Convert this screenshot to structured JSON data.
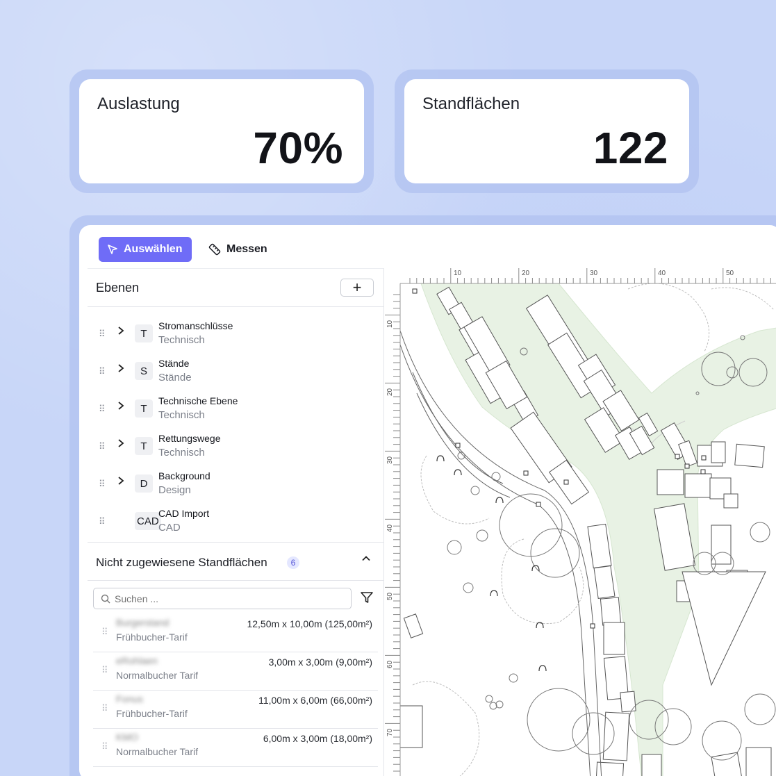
{
  "stats": [
    {
      "label": "Auslastung",
      "value": "70%"
    },
    {
      "label": "Standflächen",
      "value": "122"
    }
  ],
  "toolbar": {
    "select_label": "Auswählen",
    "measure_label": "Messen",
    "accent": "#6f6cf7"
  },
  "layers": {
    "title": "Ebenen",
    "add_label": "+",
    "items": [
      {
        "badge": "T",
        "name": "Stromanschlüsse",
        "type": "Technisch",
        "expandable": true
      },
      {
        "badge": "S",
        "name": "Stände",
        "type": "Stände",
        "expandable": true
      },
      {
        "badge": "T",
        "name": "Technische Ebene",
        "type": "Technisch",
        "expandable": true
      },
      {
        "badge": "T",
        "name": "Rettungswege",
        "type": "Technisch",
        "expandable": true
      },
      {
        "badge": "D",
        "name": "Background",
        "type": "Design",
        "expandable": true
      },
      {
        "badge": "CAD",
        "name": "CAD Import",
        "type": "CAD",
        "expandable": false
      }
    ]
  },
  "unassigned": {
    "title": "Nicht zugewiesene Standflächen",
    "count": "6",
    "search_placeholder": "Suchen ...",
    "items": [
      {
        "name": "Burgerstand",
        "tariff": "Frühbucher-Tarif",
        "dimensions": "12,50m x 10,00m (125,00m²)"
      },
      {
        "name": "eRohlaen",
        "tariff": "Normalbucher Tarif",
        "dimensions": "3,00m x 3,00m (9,00m²)"
      },
      {
        "name": "Fonus",
        "tariff": "Frühbucher-Tarif",
        "dimensions": "11,00m x 6,00m (66,00m²)"
      },
      {
        "name": "KMO",
        "tariff": "Normalbucher Tarif",
        "dimensions": "6,00m x 3,00m (18,00m²)"
      }
    ]
  },
  "ruler": {
    "top_labels": [
      "10",
      "20",
      "30",
      "40",
      "50"
    ],
    "left_labels": [
      "10",
      "20",
      "30",
      "40",
      "50",
      "60",
      "70"
    ]
  },
  "icons": {
    "select": "cursor-arrow-icon",
    "measure": "ruler-icon",
    "search": "magnifier-icon",
    "filter": "funnel-icon"
  }
}
